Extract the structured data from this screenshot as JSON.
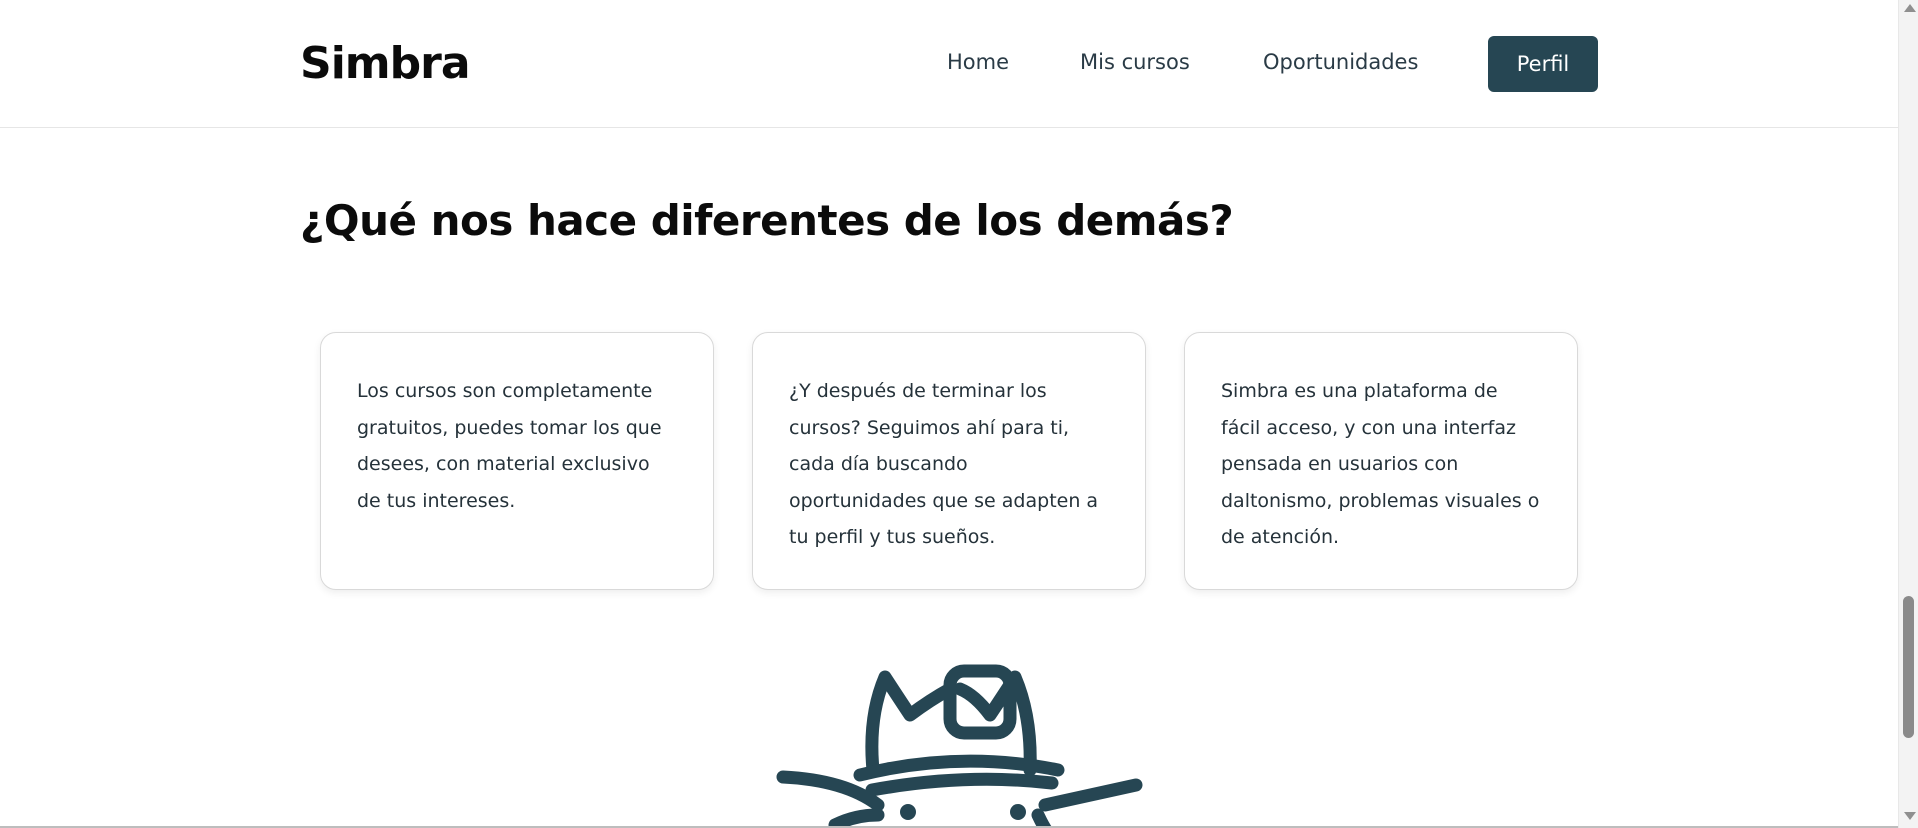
{
  "header": {
    "logo": "Simbra",
    "nav": {
      "home": "Home",
      "courses": "Mis cursos",
      "opportunities": "Oportunidades"
    },
    "profile_button": "Perfil"
  },
  "features": {
    "title": "¿Qué nos hace diferentes de los demás?",
    "cards": [
      {
        "text": "Los cursos son completamente gratuitos, puedes tomar los que desees, con material exclusivo de tus intereses."
      },
      {
        "text": "¿Y después de terminar los cursos? Seguimos ahí para ti, cada día buscando oportunidades que se adapten a tu perfil y tus sueños."
      },
      {
        "text": "Simbra es una plataforma de fácil acceso, y con una interfaz pensada en usuarios con daltonismo, problemas visuales o de atención."
      }
    ]
  },
  "mascot": {
    "icon": "hat-mascot-illustration",
    "color": "#264653"
  },
  "colors": {
    "primary": "#264653",
    "text": "#0b0b0b",
    "body_text": "#25323a"
  }
}
